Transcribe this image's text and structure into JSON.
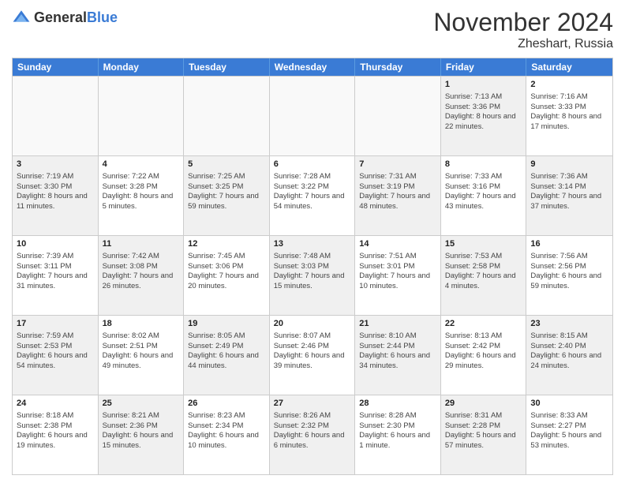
{
  "header": {
    "logo_general": "General",
    "logo_blue": "Blue",
    "title": "November 2024",
    "location": "Zheshart, Russia"
  },
  "weekdays": [
    "Sunday",
    "Monday",
    "Tuesday",
    "Wednesday",
    "Thursday",
    "Friday",
    "Saturday"
  ],
  "rows": [
    [
      {
        "day": "",
        "info": "",
        "empty": true
      },
      {
        "day": "",
        "info": "",
        "empty": true
      },
      {
        "day": "",
        "info": "",
        "empty": true
      },
      {
        "day": "",
        "info": "",
        "empty": true
      },
      {
        "day": "",
        "info": "",
        "empty": true
      },
      {
        "day": "1",
        "info": "Sunrise: 7:13 AM\nSunset: 3:36 PM\nDaylight: 8 hours and 22 minutes.",
        "shaded": true
      },
      {
        "day": "2",
        "info": "Sunrise: 7:16 AM\nSunset: 3:33 PM\nDaylight: 8 hours and 17 minutes.",
        "shaded": false
      }
    ],
    [
      {
        "day": "3",
        "info": "Sunrise: 7:19 AM\nSunset: 3:30 PM\nDaylight: 8 hours and 11 minutes.",
        "shaded": true
      },
      {
        "day": "4",
        "info": "Sunrise: 7:22 AM\nSunset: 3:28 PM\nDaylight: 8 hours and 5 minutes.",
        "shaded": false
      },
      {
        "day": "5",
        "info": "Sunrise: 7:25 AM\nSunset: 3:25 PM\nDaylight: 7 hours and 59 minutes.",
        "shaded": true
      },
      {
        "day": "6",
        "info": "Sunrise: 7:28 AM\nSunset: 3:22 PM\nDaylight: 7 hours and 54 minutes.",
        "shaded": false
      },
      {
        "day": "7",
        "info": "Sunrise: 7:31 AM\nSunset: 3:19 PM\nDaylight: 7 hours and 48 minutes.",
        "shaded": true
      },
      {
        "day": "8",
        "info": "Sunrise: 7:33 AM\nSunset: 3:16 PM\nDaylight: 7 hours and 43 minutes.",
        "shaded": false
      },
      {
        "day": "9",
        "info": "Sunrise: 7:36 AM\nSunset: 3:14 PM\nDaylight: 7 hours and 37 minutes.",
        "shaded": true
      }
    ],
    [
      {
        "day": "10",
        "info": "Sunrise: 7:39 AM\nSunset: 3:11 PM\nDaylight: 7 hours and 31 minutes.",
        "shaded": false
      },
      {
        "day": "11",
        "info": "Sunrise: 7:42 AM\nSunset: 3:08 PM\nDaylight: 7 hours and 26 minutes.",
        "shaded": true
      },
      {
        "day": "12",
        "info": "Sunrise: 7:45 AM\nSunset: 3:06 PM\nDaylight: 7 hours and 20 minutes.",
        "shaded": false
      },
      {
        "day": "13",
        "info": "Sunrise: 7:48 AM\nSunset: 3:03 PM\nDaylight: 7 hours and 15 minutes.",
        "shaded": true
      },
      {
        "day": "14",
        "info": "Sunrise: 7:51 AM\nSunset: 3:01 PM\nDaylight: 7 hours and 10 minutes.",
        "shaded": false
      },
      {
        "day": "15",
        "info": "Sunrise: 7:53 AM\nSunset: 2:58 PM\nDaylight: 7 hours and 4 minutes.",
        "shaded": true
      },
      {
        "day": "16",
        "info": "Sunrise: 7:56 AM\nSunset: 2:56 PM\nDaylight: 6 hours and 59 minutes.",
        "shaded": false
      }
    ],
    [
      {
        "day": "17",
        "info": "Sunrise: 7:59 AM\nSunset: 2:53 PM\nDaylight: 6 hours and 54 minutes.",
        "shaded": true
      },
      {
        "day": "18",
        "info": "Sunrise: 8:02 AM\nSunset: 2:51 PM\nDaylight: 6 hours and 49 minutes.",
        "shaded": false
      },
      {
        "day": "19",
        "info": "Sunrise: 8:05 AM\nSunset: 2:49 PM\nDaylight: 6 hours and 44 minutes.",
        "shaded": true
      },
      {
        "day": "20",
        "info": "Sunrise: 8:07 AM\nSunset: 2:46 PM\nDaylight: 6 hours and 39 minutes.",
        "shaded": false
      },
      {
        "day": "21",
        "info": "Sunrise: 8:10 AM\nSunset: 2:44 PM\nDaylight: 6 hours and 34 minutes.",
        "shaded": true
      },
      {
        "day": "22",
        "info": "Sunrise: 8:13 AM\nSunset: 2:42 PM\nDaylight: 6 hours and 29 minutes.",
        "shaded": false
      },
      {
        "day": "23",
        "info": "Sunrise: 8:15 AM\nSunset: 2:40 PM\nDaylight: 6 hours and 24 minutes.",
        "shaded": true
      }
    ],
    [
      {
        "day": "24",
        "info": "Sunrise: 8:18 AM\nSunset: 2:38 PM\nDaylight: 6 hours and 19 minutes.",
        "shaded": false
      },
      {
        "day": "25",
        "info": "Sunrise: 8:21 AM\nSunset: 2:36 PM\nDaylight: 6 hours and 15 minutes.",
        "shaded": true
      },
      {
        "day": "26",
        "info": "Sunrise: 8:23 AM\nSunset: 2:34 PM\nDaylight: 6 hours and 10 minutes.",
        "shaded": false
      },
      {
        "day": "27",
        "info": "Sunrise: 8:26 AM\nSunset: 2:32 PM\nDaylight: 6 hours and 6 minutes.",
        "shaded": true
      },
      {
        "day": "28",
        "info": "Sunrise: 8:28 AM\nSunset: 2:30 PM\nDaylight: 6 hours and 1 minute.",
        "shaded": false
      },
      {
        "day": "29",
        "info": "Sunrise: 8:31 AM\nSunset: 2:28 PM\nDaylight: 5 hours and 57 minutes.",
        "shaded": true
      },
      {
        "day": "30",
        "info": "Sunrise: 8:33 AM\nSunset: 2:27 PM\nDaylight: 5 hours and 53 minutes.",
        "shaded": false
      }
    ]
  ]
}
